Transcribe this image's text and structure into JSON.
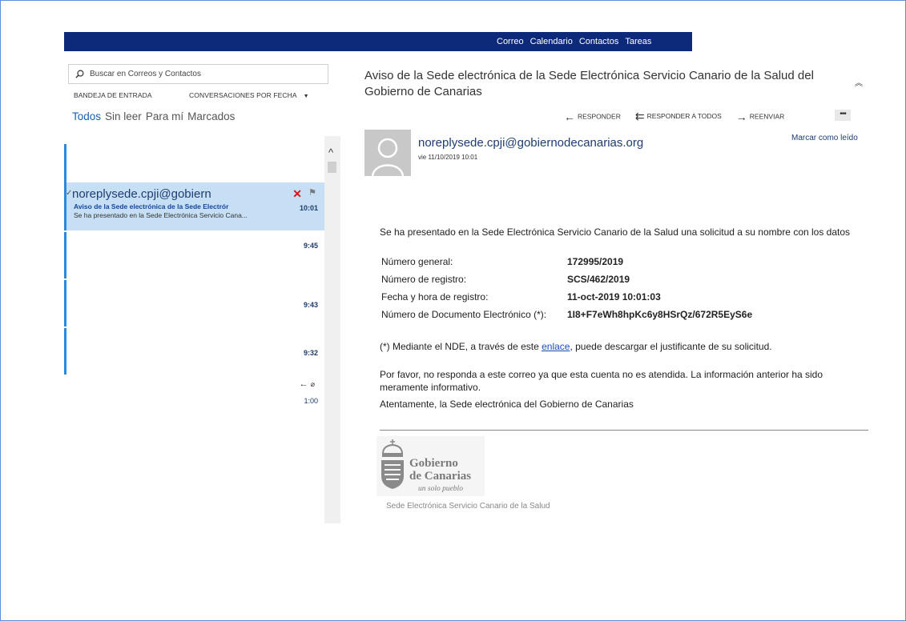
{
  "nav": {
    "items": [
      "Correo",
      "Calendario",
      "Contactos",
      "Tareas"
    ]
  },
  "search": {
    "placeholder": "Buscar en Correos y Contactos"
  },
  "folder": {
    "name": "BANDEJA DE ENTRADA",
    "sort": "CONVERSACIONES POR FECHA"
  },
  "filters": [
    "Todos",
    "Sin leer",
    "Para mí",
    "Marcados"
  ],
  "list": {
    "selected": {
      "sender": "noreplysede.cpji@gobiern",
      "subject": "Aviso de la Sede electrónica de la Sede Electrór",
      "preview": "Se ha presentado en la Sede Electrónica Servicio Cana...",
      "time": "10:01"
    },
    "times": [
      "9:45",
      "9:43",
      "9:32",
      "1:00"
    ]
  },
  "message": {
    "subject": "Aviso de la Sede electrónica de la Sede Electrónica Servicio Canario de la Salud del Gobierno de Canarias",
    "actions": {
      "reply": "RESPONDER",
      "reply_all": "RESPONDER A TODOS",
      "forward": "REENVIAR",
      "more": "•••"
    },
    "from": "noreplysede.cpji@gobiernodecanarias.org",
    "date": "vie 11/10/2019 10:01",
    "mark_read": "Marcar como leído",
    "intro": "Se ha presentado en la Sede Electrónica Servicio Canario de la Salud una solicitud a su nombre con los datos",
    "fields": [
      {
        "label": "Número general:",
        "value": "172995/2019"
      },
      {
        "label": "Número de registro:",
        "value": "SCS/462/2019"
      },
      {
        "label": "Fecha y hora de registro:",
        "value": "11-oct-2019 10:01:03"
      },
      {
        "label": "Número de Documento Electrónico (*):",
        "value": "1I8+F7eWh8hpKc6y8HSrQz/672R5EyS6e"
      }
    ],
    "nde_before": "(*) Mediante el NDE, a través de este ",
    "nde_link": "enlace",
    "nde_after": ", puede descargar el justificante de su solicitud.",
    "note": "Por favor, no responda a este correo ya que esta cuenta no es atendida. La información anterior ha sido meramente informativo.",
    "signature": "Atentamente, la Sede electrónica del Gobierno de Canarias",
    "logo": {
      "line1": "Gobierno",
      "line2": "de Canarias",
      "line3": "un solo pueblo"
    },
    "caption": "Sede Electrónica Servicio Canario de la Salud"
  }
}
